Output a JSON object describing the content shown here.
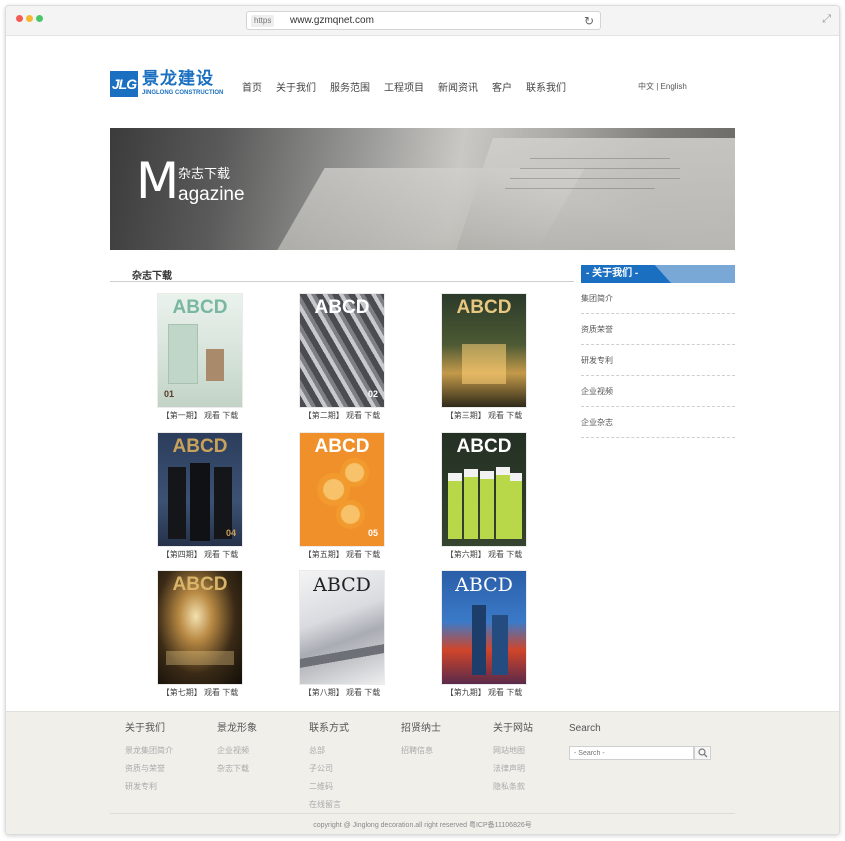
{
  "browser": {
    "https_label": "https",
    "url": "www.gzmqnet.com",
    "reload_icon": "↻",
    "expand_icon": "⤢"
  },
  "header": {
    "logo_mark": "JLG",
    "logo_cn": "景龙建设",
    "logo_en": "JINGLONG CONSTRUCTION",
    "nav": [
      "首页",
      "关于我们",
      "服务范围",
      "工程项目",
      "新闻资讯",
      "客户",
      "联系我们"
    ],
    "lang_cn": "中文",
    "lang_sep": "|",
    "lang_en": "English"
  },
  "banner": {
    "big_letter": "M",
    "title_cn": "杂志下载",
    "title_en": "agazine"
  },
  "section": {
    "title": "杂志下载"
  },
  "magazines": [
    {
      "issue": "【第一期】",
      "view": "观看",
      "download": "下载",
      "brand": "ABCD",
      "num": "01"
    },
    {
      "issue": "【第二期】",
      "view": "观看",
      "download": "下载",
      "brand": "ABCD",
      "num": "02"
    },
    {
      "issue": "【第三期】",
      "view": "观看",
      "download": "下载",
      "brand": "ABCD",
      "num": ""
    },
    {
      "issue": "【第四期】",
      "view": "观看",
      "download": "下载",
      "brand": "ABCD",
      "num": "04"
    },
    {
      "issue": "【第五期】",
      "view": "观看",
      "download": "下载",
      "brand": "ABCD",
      "num": "05"
    },
    {
      "issue": "【第六期】",
      "view": "观看",
      "download": "下载",
      "brand": "ABCD",
      "num": ""
    },
    {
      "issue": "【第七期】",
      "view": "观看",
      "download": "下载",
      "brand": "ABCD",
      "num": ""
    },
    {
      "issue": "【第八期】",
      "view": "观看",
      "download": "下载",
      "brand": "ABCD",
      "num": ""
    },
    {
      "issue": "【第九期】",
      "view": "观看",
      "download": "下载",
      "brand": "ABCD",
      "num": ""
    }
  ],
  "sidebar": {
    "title": "- 关于我们 -",
    "items": [
      "集团简介",
      "资质荣誉",
      "研发专利",
      "企业视频",
      "企业杂志"
    ]
  },
  "footer": {
    "columns": [
      {
        "title": "关于我们",
        "links": [
          "景龙集团简介",
          "资质与荣誉",
          "研发专利"
        ]
      },
      {
        "title": "景龙形象",
        "links": [
          "企业视频",
          "杂志下载"
        ]
      },
      {
        "title": "联系方式",
        "links": [
          "总部",
          "子公司",
          "二维码",
          "在线留言"
        ]
      },
      {
        "title": "招贤纳士",
        "links": [
          "招聘信息"
        ]
      },
      {
        "title": "关于网站",
        "links": [
          "网站地图",
          "法律声明",
          "隐私条款"
        ]
      }
    ],
    "search_title": "Search",
    "search_placeholder": "- Search -",
    "copyright": "copyright @ Jinglong decoration.all right reserved 粤ICP备11106826号"
  },
  "colors": {
    "brand_blue": "#1a6fc0",
    "sidebar_light_blue": "#7aa8d6",
    "footer_bg": "#f1efea"
  }
}
